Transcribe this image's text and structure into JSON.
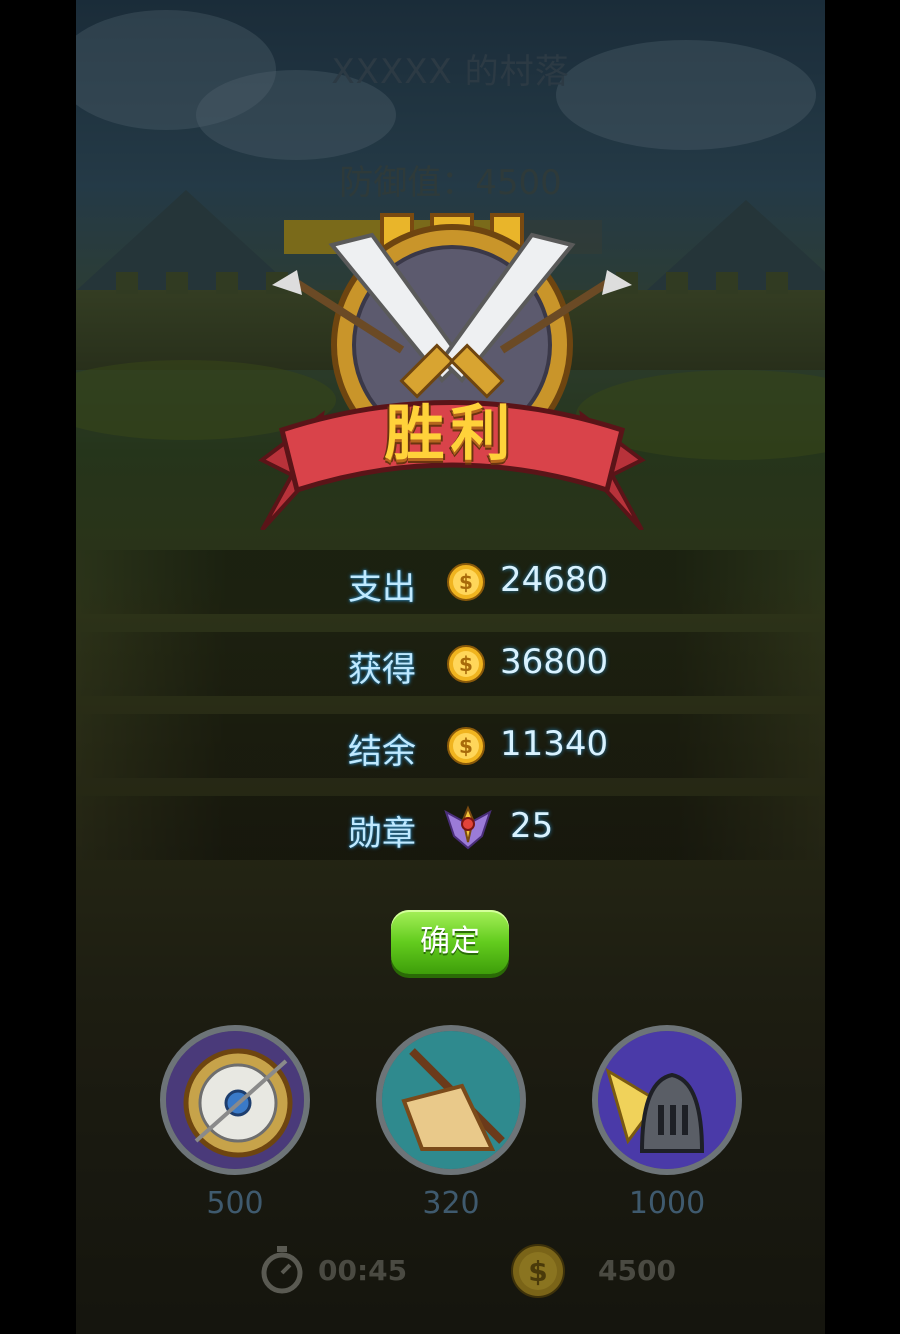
{
  "header": {
    "village_title": "XXXXX 的村落",
    "defense_label": "防御值：4500",
    "defense_progress": 0.75
  },
  "victory": {
    "title": "胜利"
  },
  "results": [
    {
      "label": "支出",
      "icon": "gold-coin-icon",
      "value": "24680"
    },
    {
      "label": "获得",
      "icon": "gold-coin-icon",
      "value": "36800"
    },
    {
      "label": "结余",
      "icon": "gold-coin-icon",
      "value": "11340"
    },
    {
      "label": "勋章",
      "icon": "medal-icon",
      "value": "25"
    }
  ],
  "confirm_button": {
    "label": "确定"
  },
  "units": [
    {
      "icon": "shield-icon",
      "cost": "500"
    },
    {
      "icon": "blade-icon",
      "cost": "320"
    },
    {
      "icon": "knight-helmet-icon",
      "cost": "1000"
    }
  ],
  "footer": {
    "timer_icon": "stopwatch-icon",
    "timer": "00:45",
    "loot_icon": "gold-coin-icon",
    "loot": "4500"
  },
  "colors": {
    "label_text": "#bfe9ff",
    "button_green": "#63cc1e",
    "gold": "#ffd23a"
  }
}
